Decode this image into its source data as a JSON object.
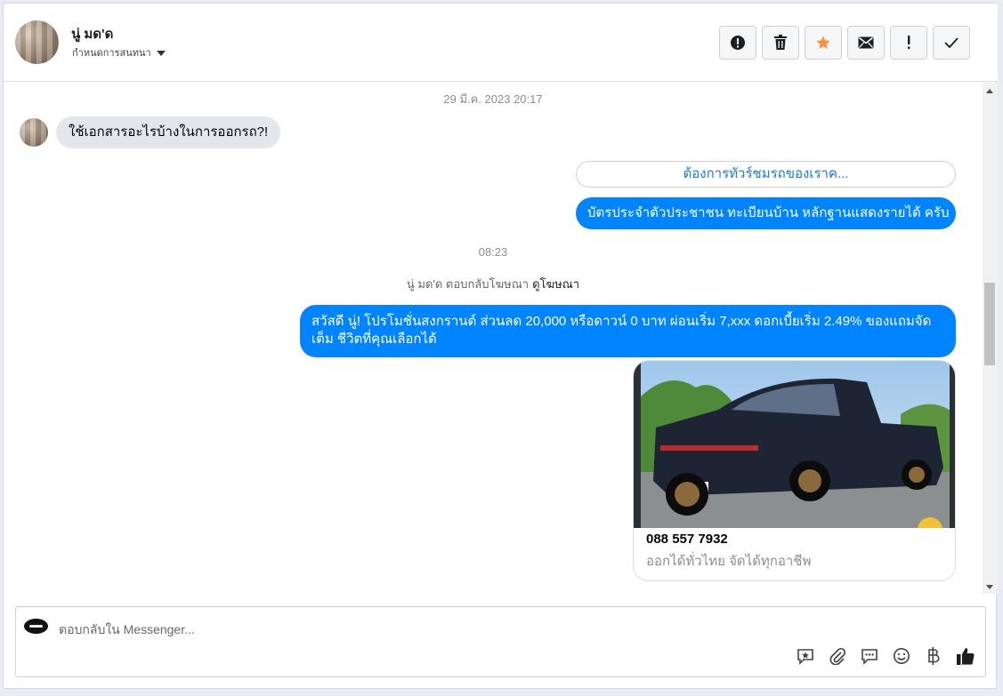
{
  "header": {
    "contact_name": "นู่ มด'ด",
    "subtitle": "กำหนดการสนทนา",
    "actions": [
      {
        "name": "report-icon"
      },
      {
        "name": "trash-icon"
      },
      {
        "name": "star-icon",
        "color": "#f7923a"
      },
      {
        "name": "mail-icon"
      },
      {
        "name": "important-icon"
      },
      {
        "name": "check-icon"
      }
    ]
  },
  "chat": {
    "timestamp_1": "29 มี.ค. 2023 20:17",
    "incoming_message": "ใช้เอกสารอะไรบ้างในการออกรถ?!",
    "quick_reply": "ต้องการทัวร์ชมรถของเราค...",
    "outgoing_message_1": "บัตรประจำตัวประชาชน ทะเบียนบ้าน หลักฐานแสดงรายได้ ครับ",
    "timestamp_2": "08:23",
    "ad_note": "นู่ มด'ด ตอบกลับโฆษณา",
    "ad_link": "ดูโฆษณา",
    "outgoing_message_2": "สวัสดี นู่! โปรโมชั่นสงกรานต์ ส่วนลด 20,000 หรือดาวน์ 0 บาท ผ่อนเริ่ม 7,xxx ดอกเบี้ยเริ่ม 2.49% ของแถมจัดเต็ม ชีวิตที่คุณเลือกได้",
    "card": {
      "title": "088 557 7932",
      "subtitle": "ออกได้ทั่วไทย จัดได้ทุกอาชีพ"
    }
  },
  "composer": {
    "placeholder": "ตอบกลับใน Messenger...",
    "tools": [
      "saved-reply-icon",
      "attachment-icon",
      "comment-icon",
      "emoji-icon",
      "baht-icon",
      "like-icon"
    ]
  },
  "colors": {
    "outgoing_bubble": "#0084ff",
    "incoming_bubble": "#e4e6eb",
    "link": "#1877f2"
  }
}
